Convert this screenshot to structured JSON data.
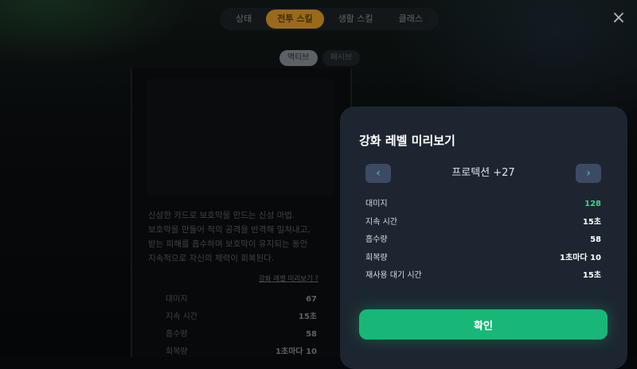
{
  "tabs": [
    "상태",
    "전투 스킬",
    "생활 스킬",
    "클래스"
  ],
  "subtabs": [
    "액티브",
    "패시브"
  ],
  "close_icon": "×",
  "skill": {
    "description": "신성한 카드로 보호막을 만드는 신성 마법.\n보호막을 만들어 적의 공격을 반격해 밀쳐내고,\n받는 피해를 흡수하며 보호막이 유지되는 동안\n지속적으로 자신의 체력이 회복된다.",
    "preview_link": "강화 레벨 미리보기 ?",
    "stats": [
      {
        "label": "대미지",
        "value": "67"
      },
      {
        "label": "지속 시간",
        "value": "15초"
      },
      {
        "label": "흡수량",
        "value": "58"
      },
      {
        "label": "회복량",
        "value": "1초마다 10"
      }
    ]
  },
  "modal": {
    "title": "강화 레벨 미리보기",
    "level_name": "프로텍션 +27",
    "prev_icon": "‹",
    "next_icon": "›",
    "stats": [
      {
        "label": "대미지",
        "value": "128"
      },
      {
        "label": "지속 시간",
        "value": "15초"
      },
      {
        "label": "흡수량",
        "value": "58"
      },
      {
        "label": "회복량",
        "value": "1초마다 10"
      },
      {
        "label": "재사용 대기 시간",
        "value": "15초"
      }
    ],
    "confirm_label": "확인",
    "accent_color": "#19b777",
    "highlight_color": "#3fd28f"
  }
}
